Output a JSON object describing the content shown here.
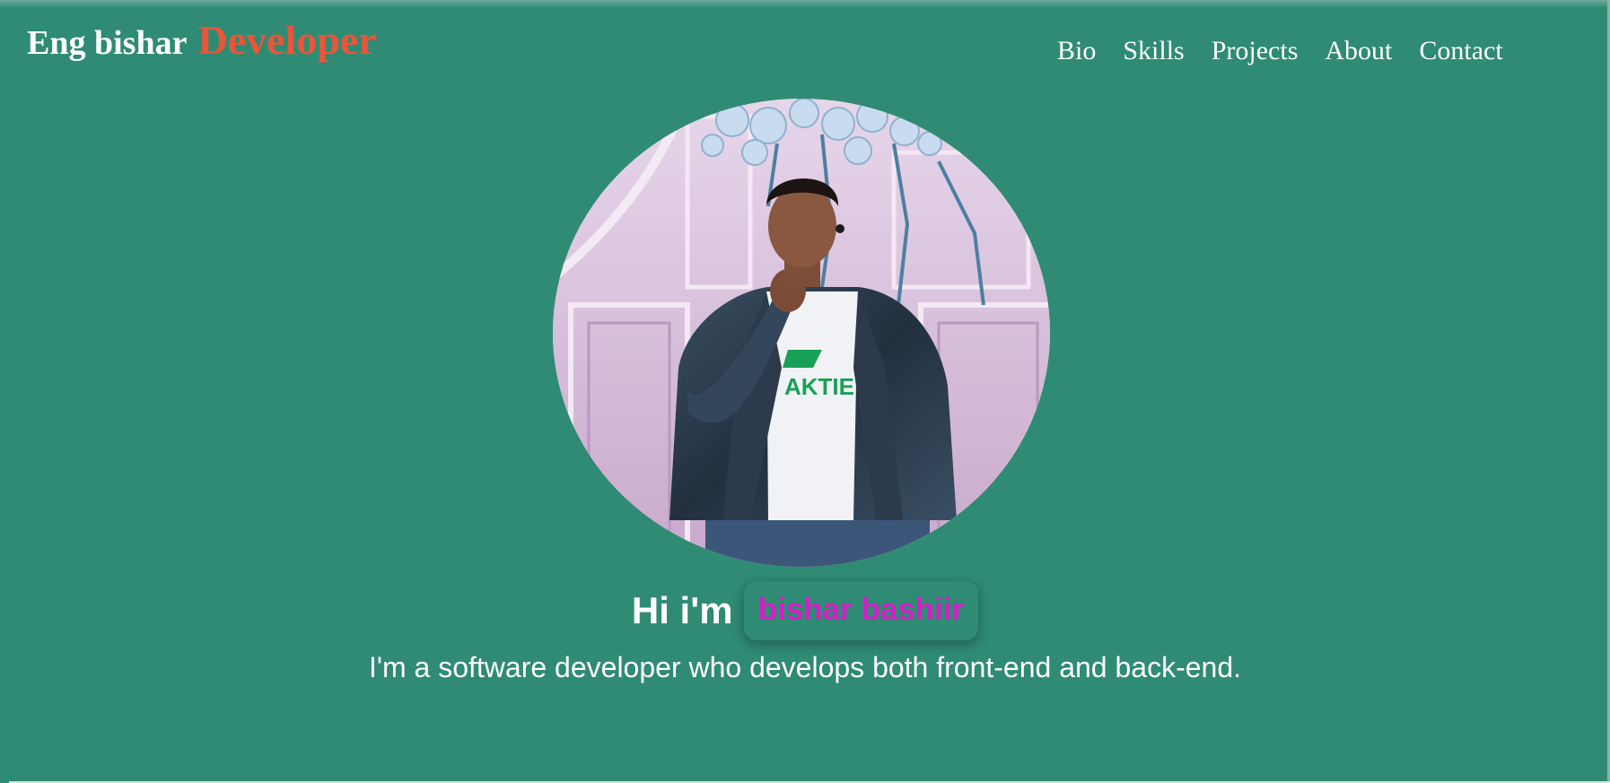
{
  "brand": {
    "name": "Eng bishar",
    "accent": "Developer"
  },
  "nav": {
    "items": [
      "Bio",
      "Skills",
      "Projects",
      "About",
      "Contact"
    ]
  },
  "hero": {
    "greeting": "Hi i'm",
    "name": "bishar bashiir",
    "tagline": "I'm a software developer who develops both front-end and back-end."
  },
  "colors": {
    "background": "#2f8b74",
    "accent": "#e8563a",
    "name_highlight": "#d41ec6",
    "text": "#ffffff"
  },
  "images": {
    "avatar": "profile-photo"
  }
}
